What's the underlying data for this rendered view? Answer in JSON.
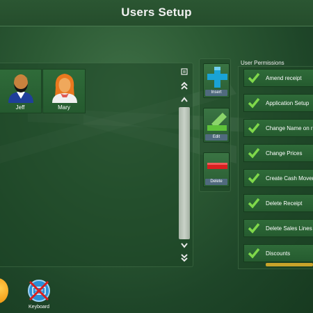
{
  "title": "Users Setup",
  "users": [
    {
      "name": "Jeff",
      "icon": "user-male-avatar-icon"
    },
    {
      "name": "Mary",
      "icon": "user-female-avatar-icon"
    }
  ],
  "actions": {
    "insert_label": "Insert",
    "edit_label": "Edit",
    "delete_label": "Delete"
  },
  "permissions": {
    "header": "User Permissions",
    "items": [
      "Amend receipt",
      "Application Setup",
      "Change Name on receipt",
      "Change Prices",
      "Create Cash Movement",
      "Delete Receipt",
      "Delete Sales Lines",
      "Discounts"
    ]
  },
  "bottom": {
    "keyboard_label": "Keyboard"
  },
  "colors": {
    "background": "#2c5a34",
    "tile": "#2f6b39",
    "accent_blue": "#1aa3d6",
    "accent_green": "#5fc23a",
    "accent_red": "#d81f1f",
    "label_bg": "#506a7e",
    "scroll_thumb": "#c8a32a"
  }
}
